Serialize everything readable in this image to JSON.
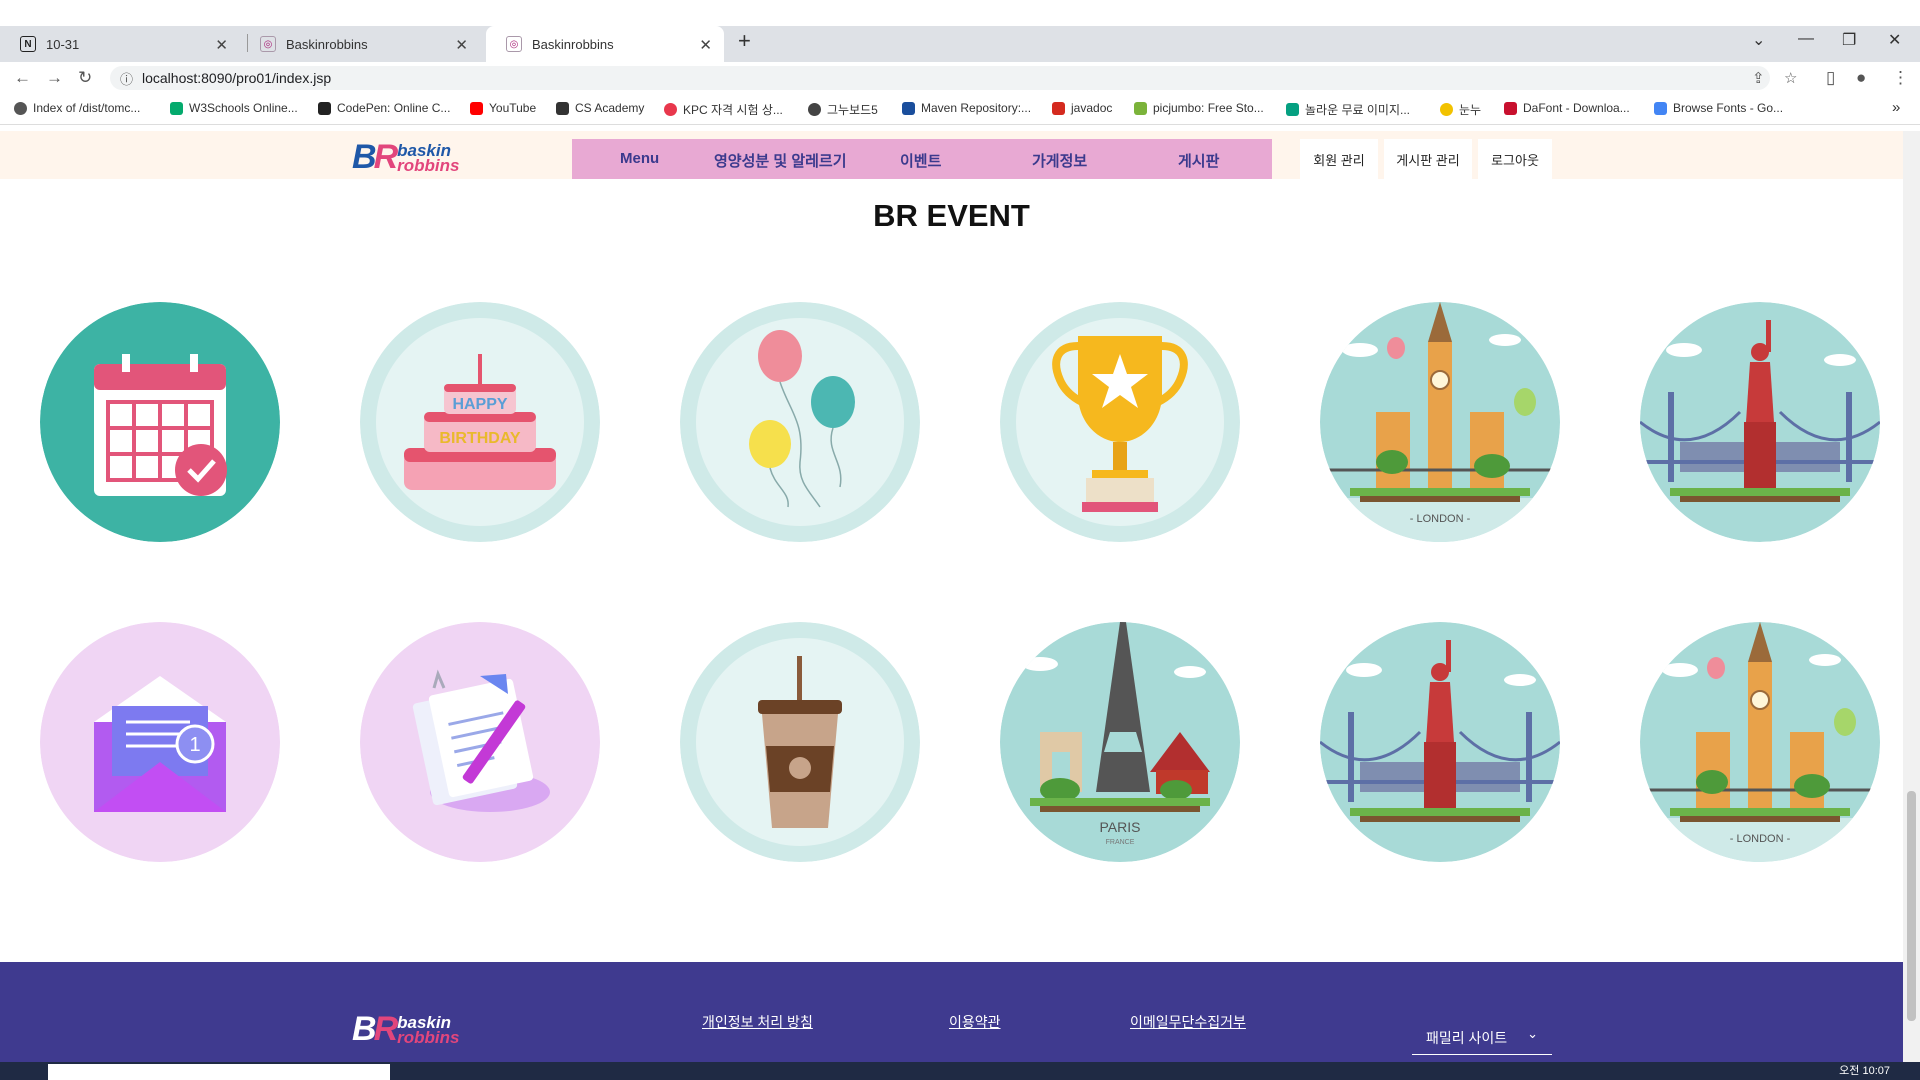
{
  "browser": {
    "tabs": [
      {
        "title": "10-31",
        "favicon": "notion-icon",
        "active": false
      },
      {
        "title": "Baskinrobbins",
        "favicon": "br-icon",
        "active": false
      },
      {
        "title": "Baskinrobbins",
        "favicon": "br-icon",
        "active": true
      }
    ],
    "url": "localhost:8090/pro01/index.jsp",
    "bookmarks": [
      {
        "label": "Index of /dist/tomc...",
        "color": "#555555"
      },
      {
        "label": "W3Schools Online...",
        "color": "#04aa6d"
      },
      {
        "label": "CodePen: Online C...",
        "color": "#222222"
      },
      {
        "label": "YouTube",
        "color": "#ff0000"
      },
      {
        "label": "CS Academy",
        "color": "#333333"
      },
      {
        "label": "KPC 자격 시험 상...",
        "color": "#e8374c"
      },
      {
        "label": "그누보드5",
        "color": "#444444"
      },
      {
        "label": "Maven Repository:...",
        "color": "#1a4e9c"
      },
      {
        "label": "javadoc",
        "color": "#d42a1f"
      },
      {
        "label": "picjumbo: Free Sto...",
        "color": "#7bb33a"
      },
      {
        "label": "놀라운 무료 이미지...",
        "color": "#05a081"
      },
      {
        "label": "눈누",
        "color": "#f2c200"
      },
      {
        "label": "DaFont - Downloa...",
        "color": "#c8102e"
      },
      {
        "label": "Browse Fonts - Go...",
        "color": "#4285f4"
      }
    ]
  },
  "header": {
    "logo": {
      "br": "BR",
      "word1": "baskin",
      "word2": "robbins"
    },
    "nav": [
      "Menu",
      "영양성분 및 알레르기",
      "이벤트",
      "가게정보",
      "게시판"
    ],
    "util": [
      "회원 관리",
      "게시판 관리",
      "로그아웃"
    ]
  },
  "main": {
    "title": "BR EVENT",
    "circle_labels": {
      "london": "- LONDON -",
      "paris": "PARIS",
      "paris_sub": "FRANCE"
    }
  },
  "footer": {
    "links": [
      "개인정보 처리 방침",
      "이용약관",
      "이메일무단수집거부"
    ],
    "family_site": "패밀리 사이트"
  },
  "taskbar": {
    "clock": "오전 10:07"
  },
  "colors": {
    "nav_bg": "#e8a9d3",
    "footer_bg": "#3f3a8f",
    "header_bg": "#fff5ec",
    "nav_text": "#3b3a8d"
  }
}
